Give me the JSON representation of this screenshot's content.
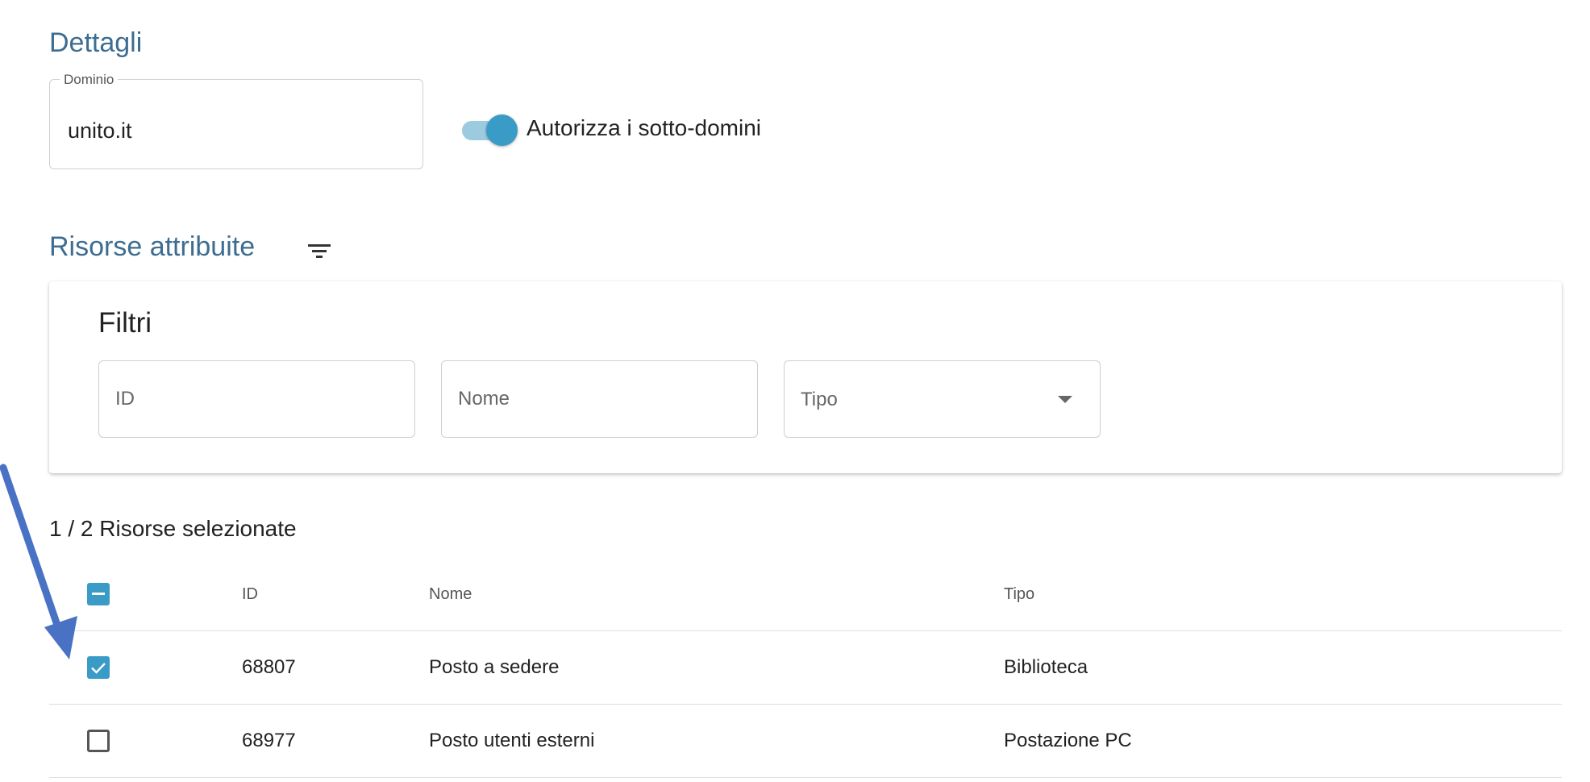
{
  "details": {
    "title": "Dettagli",
    "domain_label": "Dominio",
    "domain_value": "unito.it",
    "subdomain_toggle_label": "Autorizza i sotto-domini",
    "subdomain_toggle_on": true
  },
  "resources": {
    "title": "Risorse attribuite",
    "filter_icon": "filter-list-icon"
  },
  "filters": {
    "title": "Filtri",
    "id_placeholder": "ID",
    "name_placeholder": "Nome",
    "type_placeholder": "Tipo"
  },
  "selection": {
    "summary": "1 / 2 Risorse selezionate"
  },
  "table": {
    "headers": {
      "id": "ID",
      "name": "Nome",
      "type": "Tipo"
    },
    "rows": [
      {
        "id": "68807",
        "name": "Posto a sedere",
        "type": "Biblioteca",
        "selected": true
      },
      {
        "id": "68977",
        "name": "Posto utenti esterni",
        "type": "Postazione PC",
        "selected": false
      }
    ]
  },
  "colors": {
    "accent": "#3a9bc6",
    "title": "#3d6d91",
    "annotation": "#4a72c4"
  }
}
